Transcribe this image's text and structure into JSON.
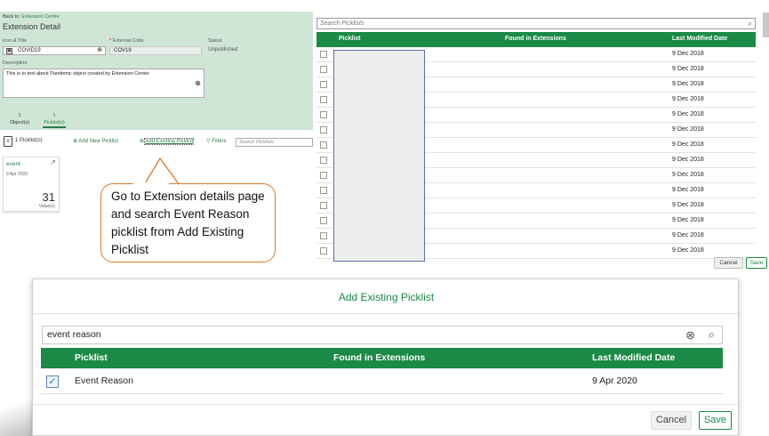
{
  "extension": {
    "back_prefix": "Back to:",
    "back_link": "Extension Centre",
    "title": "Extension Detail",
    "icon_title_label": "Icon & Title",
    "icon_title_value": "COVID19",
    "external_code_label": "External Code",
    "external_code_required": "*",
    "external_code_value": "COV19",
    "status_label": "Status",
    "status_value": "Unpublished",
    "description_label": "Description",
    "description_value": "This is to test about Pandemic object created by Extension Center",
    "tabs": [
      {
        "count": "1",
        "label": "Object(s)"
      },
      {
        "count": "1",
        "label": "Picklist(s)"
      }
    ]
  },
  "picklist_bar": {
    "count_label": "1 Picklist(s)",
    "add_new": "Add New Picklist",
    "add_existing": "Add Existing Picklist",
    "filters": "Filters",
    "search_placeholder": "Search Picklists"
  },
  "event_card": {
    "name": "event",
    "date": "9 Apr 2020",
    "value_count": "31",
    "value_label": "Value(s)"
  },
  "callout": {
    "text": "Go to Extension details page and search Event Reason picklist from Add Existing Picklist"
  },
  "picklist_browser": {
    "search_placeholder": "Search Picklists",
    "columns": [
      "Picklist",
      "Found in Extensions",
      "Last Modified Date"
    ],
    "row_dates": [
      "9 Dec 2018",
      "9 Dec 2018",
      "9 Dec 2018",
      "9 Dec 2018",
      "9 Dec 2018",
      "9 Dec 2018",
      "9 Dec 2018",
      "9 Dec 2018",
      "9 Dec 2018",
      "9 Dec 2018",
      "9 Dec 2018",
      "9 Dec 2018",
      "9 Dec 2018",
      "9 Dec 2018"
    ],
    "cancel": "Cancel",
    "save": "Save"
  },
  "dialog": {
    "title": "Add Existing Picklist",
    "search_value": "event reason",
    "columns": [
      "Picklist",
      "Found in Extensions",
      "Last Modified Date"
    ],
    "rows": [
      {
        "picklist": "Event Reason",
        "found_in": "",
        "date": "9 Apr 2020",
        "checked": true
      }
    ],
    "cancel": "Cancel",
    "save": "Save"
  },
  "colors": {
    "accent": "#1a8a46",
    "panel_bg": "#cfe6d6",
    "callout_border": "#d97b2a"
  }
}
